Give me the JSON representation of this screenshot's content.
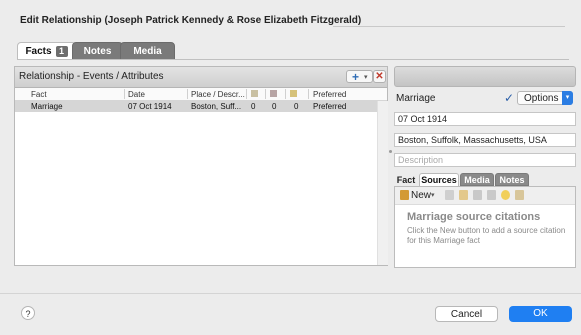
{
  "dialog": {
    "title": "Edit Relationship (Joseph Patrick Kennedy & Rose Elizabeth Fitzgerald)"
  },
  "tabs": [
    {
      "label": "Facts",
      "badge": "1",
      "active": true
    },
    {
      "label": "Notes",
      "active": false
    },
    {
      "label": "Media",
      "active": false
    }
  ],
  "events_panel": {
    "title": "Relationship - Events / Attributes",
    "add_icon": "plus-icon",
    "delete_icon": "x-icon",
    "columns": {
      "fact": "Fact",
      "date": "Date",
      "place": "Place / Descr...",
      "sources_icon": "sources-icon",
      "media_icon": "media-icon",
      "notes_icon": "notes-icon",
      "preferred": "Preferred"
    },
    "rows": [
      {
        "fact": "Marriage",
        "date": "07 Oct 1914",
        "place": "Boston, Suff...",
        "sources": "0",
        "media": "0",
        "notes": "0",
        "preferred": "Preferred"
      }
    ]
  },
  "detail": {
    "fact_name": "Marriage",
    "check_icon": "checkmark-icon",
    "options_label": "Options",
    "date_value": "07 Oct 1914",
    "place_value": "Boston, Suffolk, Massachusetts, USA",
    "description_placeholder": "Description",
    "subtabs": [
      "Fact",
      "Sources",
      "Media",
      "Notes"
    ],
    "active_subtab": "Sources",
    "sources": {
      "new_label": "New",
      "empty_title": "Marriage source citations",
      "empty_desc": "Click the New button to add a source citation for this Marriage fact"
    }
  },
  "footer": {
    "help": "?",
    "cancel": "Cancel",
    "ok": "OK"
  },
  "colors": {
    "accent": "#1f7ff2",
    "selected_row": "#d6d6d6",
    "inactive_tab": "#7a7a7a"
  }
}
